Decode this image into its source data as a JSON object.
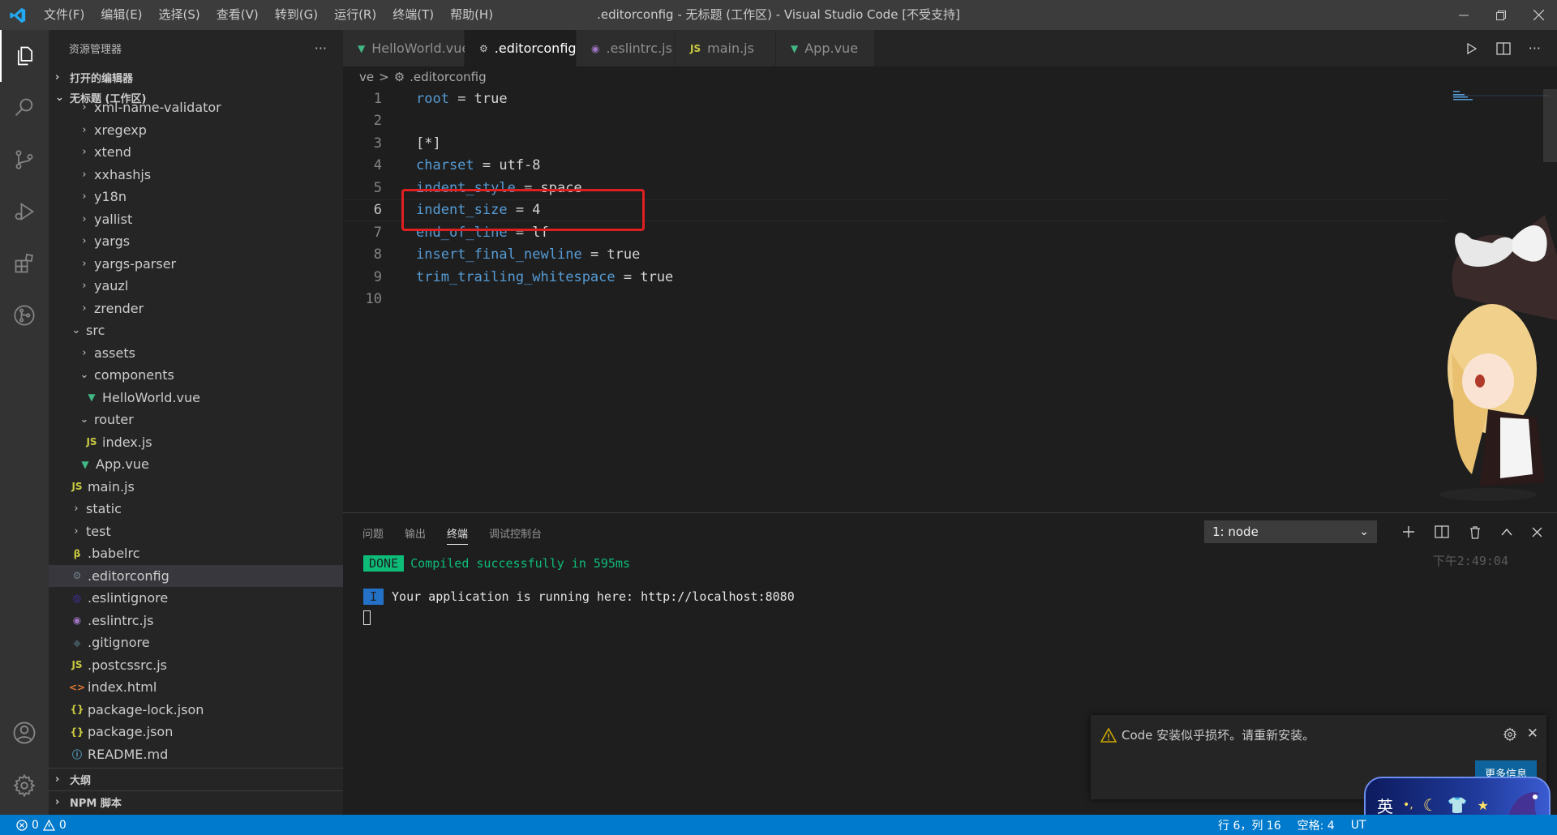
{
  "window": {
    "title": ".editorconfig - 无标题 (工作区) - Visual Studio Code [不受支持]"
  },
  "menu": [
    "文件(F)",
    "编辑(E)",
    "选择(S)",
    "查看(V)",
    "转到(G)",
    "运行(R)",
    "终端(T)",
    "帮助(H)"
  ],
  "sidebar": {
    "title": "资源管理器",
    "more": "···",
    "open_editors": "打开的编辑器",
    "workspace": "无标题 (工作区)",
    "outline": "大纲",
    "npm": "NPM 脚本",
    "tree": [
      {
        "label": "xml-name-validator",
        "type": "folder"
      },
      {
        "label": "xregexp",
        "type": "folder"
      },
      {
        "label": "xtend",
        "type": "folder"
      },
      {
        "label": "xxhashjs",
        "type": "folder"
      },
      {
        "label": "y18n",
        "type": "folder"
      },
      {
        "label": "yallist",
        "type": "folder"
      },
      {
        "label": "yargs",
        "type": "folder"
      },
      {
        "label": "yargs-parser",
        "type": "folder"
      },
      {
        "label": "yauzl",
        "type": "folder"
      },
      {
        "label": "zrender",
        "type": "folder"
      },
      {
        "label": "src",
        "type": "folder-open"
      },
      {
        "label": "assets",
        "type": "folder"
      },
      {
        "label": "components",
        "type": "folder-open"
      },
      {
        "label": "HelloWorld.vue",
        "type": "vue"
      },
      {
        "label": "router",
        "type": "folder-open"
      },
      {
        "label": "index.js",
        "type": "js"
      },
      {
        "label": "App.vue",
        "type": "vue"
      },
      {
        "label": "main.js",
        "type": "js"
      },
      {
        "label": "static",
        "type": "folder"
      },
      {
        "label": "test",
        "type": "folder"
      },
      {
        "label": ".babelrc",
        "type": "babel"
      },
      {
        "label": ".editorconfig",
        "type": "gear"
      },
      {
        "label": ".eslintignore",
        "type": "circle"
      },
      {
        "label": ".eslintrc.js",
        "type": "eslint"
      },
      {
        "label": ".gitignore",
        "type": "git"
      },
      {
        "label": ".postcssrc.js",
        "type": "js"
      },
      {
        "label": "index.html",
        "type": "html"
      },
      {
        "label": "package-lock.json",
        "type": "json"
      },
      {
        "label": "package.json",
        "type": "json"
      },
      {
        "label": "README.md",
        "type": "info"
      }
    ]
  },
  "tabs": [
    {
      "label": "HelloWorld.vue",
      "icon": "vue",
      "active": false
    },
    {
      "label": ".editorconfig",
      "icon": "gear",
      "active": true
    },
    {
      "label": ".eslintrc.js",
      "icon": "eslint",
      "active": false
    },
    {
      "label": "main.js",
      "icon": "js",
      "active": false
    },
    {
      "label": "App.vue",
      "icon": "vue",
      "active": false
    }
  ],
  "breadcrumb": {
    "part1": "ve",
    "sep": ">",
    "file": ".editorconfig"
  },
  "code": [
    {
      "n": "1",
      "k": "root",
      "v": " = true"
    },
    {
      "n": "2",
      "k": "",
      "v": ""
    },
    {
      "n": "3",
      "k": "",
      "v": "[*]"
    },
    {
      "n": "4",
      "k": "charset",
      "v": " = utf-8"
    },
    {
      "n": "5",
      "k": "indent_style",
      "v": " = space"
    },
    {
      "n": "6",
      "k": "indent_size",
      "v": " = 4"
    },
    {
      "n": "7",
      "k": "end_of_line",
      "v": " = lf"
    },
    {
      "n": "8",
      "k": "insert_final_newline",
      "v": " = true"
    },
    {
      "n": "9",
      "k": "trim_trailing_whitespace",
      "v": " = true"
    },
    {
      "n": "10",
      "k": "",
      "v": ""
    }
  ],
  "panel": {
    "tabs": [
      "问题",
      "输出",
      "终端",
      "调试控制台"
    ],
    "active_tab": "终端",
    "terminal_select": "1: node",
    "done_badge": "DONE",
    "compiled": "Compiled successfully in 595ms",
    "time": "下午2:49:04",
    "info_badge": "I",
    "running": "Your application is running here: http://localhost:8080"
  },
  "notification": {
    "message": "Code 安装似乎损坏。请重新安装。",
    "button": "更多信息"
  },
  "ime": {
    "label": "英"
  },
  "status": {
    "errors": "0",
    "warnings": "0",
    "position": "行 6，列 16",
    "spaces": "空格: 4",
    "encoding": "UT"
  }
}
